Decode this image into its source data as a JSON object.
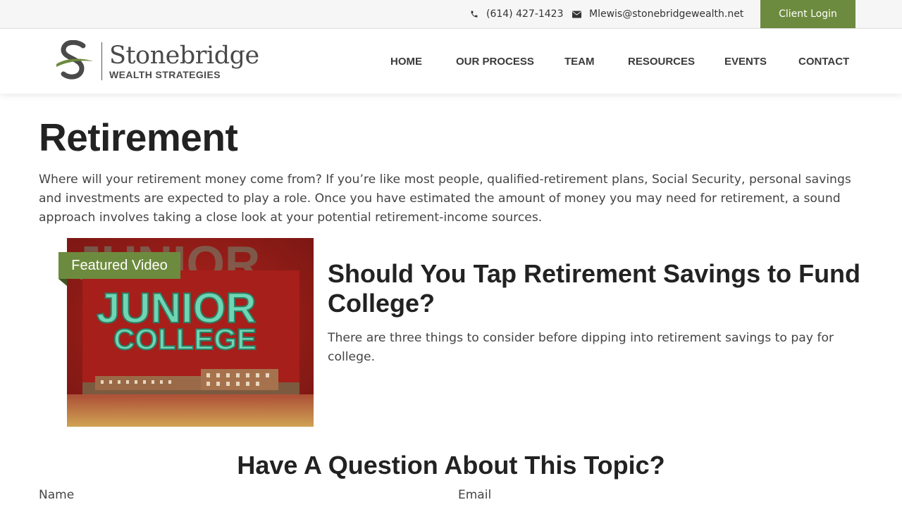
{
  "topbar": {
    "phone": "(614) 427-1423",
    "email": "Mlewis@stonebridgewealth.net",
    "client_login": "Client Login"
  },
  "brand": {
    "name": "Stonebridge",
    "tagline": "WEALTH STRATEGIES",
    "accent_color": "#6d8b3e"
  },
  "nav": {
    "items": [
      "HOME",
      "OUR PROCESS",
      "TEAM",
      "RESOURCES",
      "EVENTS",
      "CONTACT"
    ]
  },
  "main": {
    "title": "Retirement",
    "intro": "Where will your retirement money come from? If you’re like most people, qualified-retirement plans, Social Security, personal savings and investments are expected to play a role. Once you have estimated the amount of money you may need for retirement, a sound approach involves taking a close look at your potential retirement-income sources."
  },
  "featured": {
    "tag": "Featured Video",
    "thumb_title_line1": "JUNIOR",
    "thumb_title_line2": "COLLEGE",
    "title": "Should You Tap Retirement Savings to Fund College?",
    "description": "There are three things to consider before dipping into retirement savings to pay for college."
  },
  "form": {
    "heading": "Have A Question About This Topic?",
    "name_label": "Name",
    "email_label": "Email"
  },
  "icons": {
    "phone": "phone-icon",
    "email": "envelope-icon"
  }
}
